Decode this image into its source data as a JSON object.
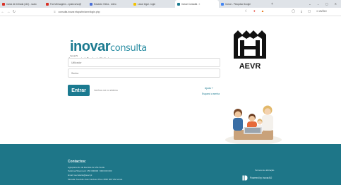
{
  "browser": {
    "tabs": [
      {
        "label": "Caixa de entrada (113) - scalo",
        "color": "#d93025",
        "active": false
      },
      {
        "label": "Fax Mensagens - vpaincurso@",
        "color": "#d93025",
        "active": false
      },
      {
        "label": "Eduardo Vieira - vídeo",
        "color": "#4a6fd8",
        "active": false
      },
      {
        "label": "Lavar legal - login",
        "color": "#f2c200",
        "active": false
      },
      {
        "label": "Inovar Consulta",
        "color": "#1b7a90",
        "active": true
      },
      {
        "label": "Inovar - Pesquisa Google",
        "color": "#4285f4",
        "active": false
      }
    ],
    "new_tab_label": "+",
    "window_controls": [
      "⌄",
      "–",
      "▢",
      "✕"
    ],
    "url": "consulta.inovar.etapa/ivr/aevr/login.php",
    "right_menu_text": "o aviso"
  },
  "login": {
    "logo_main": "inovar",
    "logo_secondary": "consulta",
    "logo_tagline": "Inovar/S",
    "subtitle": "Agrupamento de Escolas de Vila Verde",
    "username_placeholder": "Utilizador",
    "password_placeholder": "Senha",
    "submit_label": "Entrar",
    "remember_label": "Lembrar-me no sistema",
    "help_link": "Ajuda ?",
    "forgot_link": "Esqueci a senha",
    "school_logo_text": "AEVR"
  },
  "footer": {
    "title": "Contactos:",
    "lines": [
      "Agrupamento de Escolas de Vila Verde",
      "Telefone/Telemóvel: 253 000000 / 000 000 000",
      "Email: secretaria@aevr.pt",
      "Morada: Avenida José Cardoso Pires 4830 000 Vila Verde"
    ],
    "terms": "Termos de utilização",
    "powered_by": "Powered by InovarAO"
  },
  "colors": {
    "brand": "#1b7a90",
    "footer_bg": "#1e7688"
  }
}
